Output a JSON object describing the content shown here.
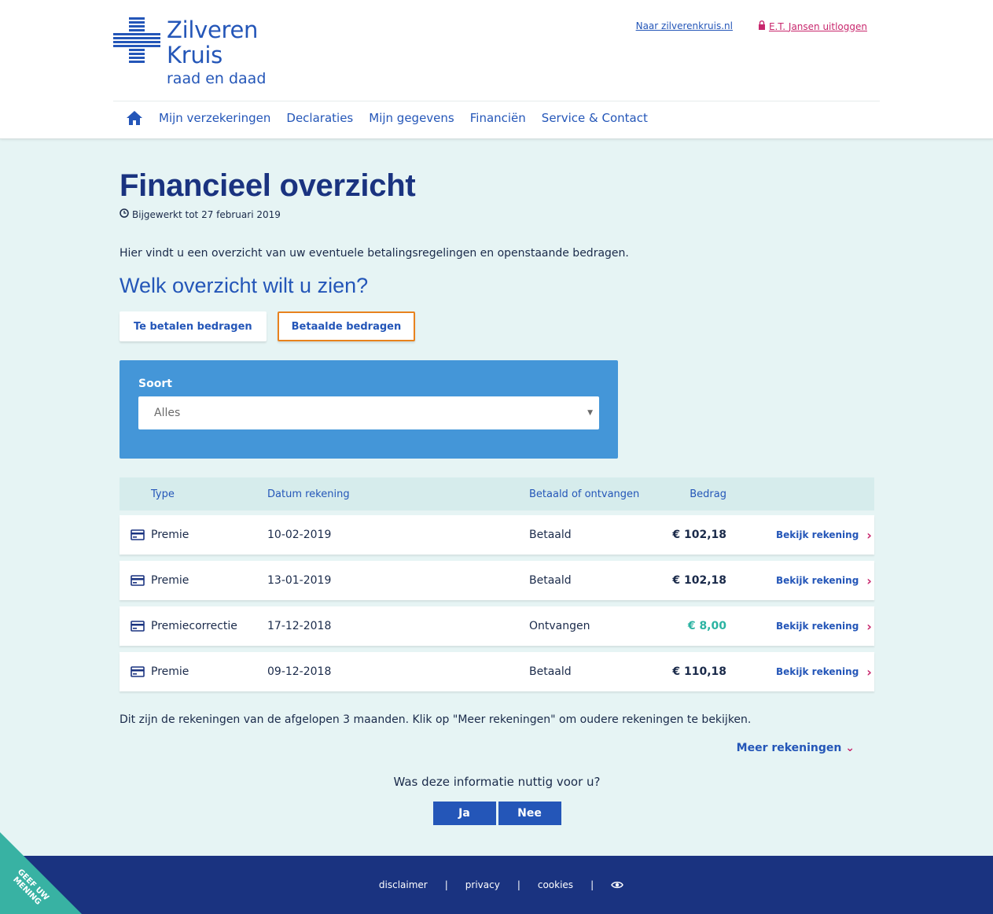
{
  "brand": {
    "line1": "Zilveren",
    "line2": "Kruis",
    "line3": "raad en daad",
    "color": "#2456b8"
  },
  "top_links": {
    "site": "Naar zilverenkruis.nl",
    "logout": "E.T. Jansen uitloggen",
    "logout_icon": "lock-icon"
  },
  "nav": {
    "home_icon": "home-icon",
    "items": [
      "Mijn verzekeringen",
      "Declaraties",
      "Mijn gegevens",
      "Financiën",
      "Service & Contact"
    ]
  },
  "page": {
    "title": "Financieel overzicht",
    "updated": "Bijgewerkt tot 27 februari 2019",
    "intro": "Hier vindt u een overzicht van uw eventuele betalingsregelingen en openstaande bedragen.",
    "question": "Welk overzicht wilt u zien?"
  },
  "toggle": {
    "to_pay": "Te betalen bedragen",
    "paid": "Betaalde bedragen",
    "active": "paid"
  },
  "filter": {
    "label": "Soort",
    "selected": "Alles"
  },
  "table": {
    "headers": {
      "type": "Type",
      "date": "Datum rekening",
      "status": "Betaald of ontvangen",
      "amount": "Bedrag"
    },
    "rows": [
      {
        "type": "Premie",
        "date": "10-02-2019",
        "status": "Betaald",
        "amount": "€ 102,18",
        "link": "Bekijk rekening"
      },
      {
        "type": "Premie",
        "date": "13-01-2019",
        "status": "Betaald",
        "amount": "€ 102,18",
        "link": "Bekijk rekening"
      },
      {
        "type": "Premiecorrectie",
        "date": "17-12-2018",
        "status": "Ontvangen",
        "amount": "€ 8,00",
        "link": "Bekijk rekening"
      },
      {
        "type": "Premie",
        "date": "09-12-2018",
        "status": "Betaald",
        "amount": "€ 110,18",
        "link": "Bekijk rekening"
      }
    ]
  },
  "note": "Dit zijn de rekeningen van de afgelopen 3 maanden. Klik op \"Meer rekeningen\" om oudere rekeningen te bekijken.",
  "more": "Meer rekeningen",
  "feedback": {
    "question": "Was deze informatie nuttig voor u?",
    "yes": "Ja",
    "no": "Nee"
  },
  "footer": {
    "links": [
      "disclaimer",
      "privacy",
      "cookies"
    ],
    "separator": "|",
    "eye_icon": "eye-icon"
  },
  "ribbon": {
    "line1": "GEEF UW",
    "line2": "MENING"
  }
}
